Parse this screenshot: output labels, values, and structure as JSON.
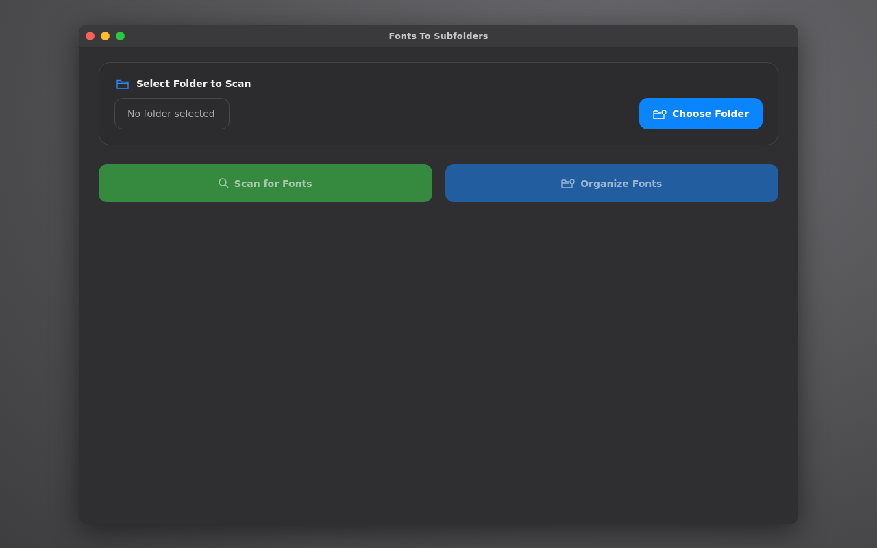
{
  "window": {
    "title": "Fonts To Subfolders"
  },
  "folder_panel": {
    "heading": "Select Folder to Scan",
    "path_field": {
      "placeholder": "No folder selected"
    },
    "choose_button": {
      "label": "Choose Folder",
      "disabled": false
    }
  },
  "actions": [
    {
      "kind": "scan",
      "label": "Scan for Fonts",
      "disabled": true
    },
    {
      "kind": "organize",
      "label": "Organize Fonts",
      "disabled": true
    }
  ]
}
